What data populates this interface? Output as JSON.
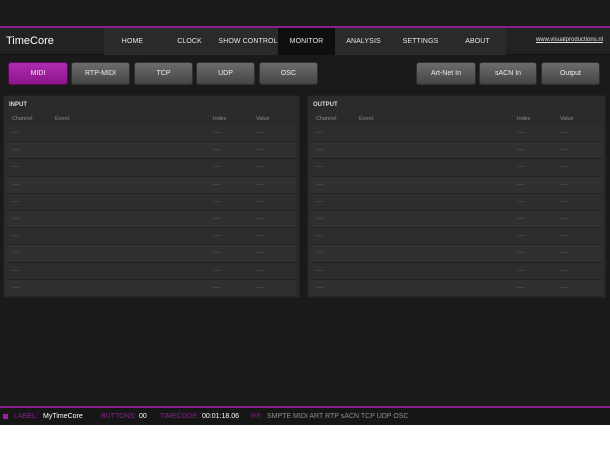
{
  "app": {
    "title": "TimeCore"
  },
  "nav": [
    {
      "label": "HOME"
    },
    {
      "label": "CLOCK"
    },
    {
      "label": "SHOW CONTROL"
    },
    {
      "label": "MONITOR"
    },
    {
      "label": "ANALYSIS"
    },
    {
      "label": "SETTINGS"
    },
    {
      "label": "ABOUT"
    }
  ],
  "site_link": "www.visualproductions.nl",
  "source_buttons": {
    "midi": "MIDI",
    "rtp_midi": "RTP-MIDI",
    "tcp": "TCP",
    "udp": "UDP",
    "osc": "OSC",
    "artnet_in": "Art-Net In",
    "sacn_in": "sACN In",
    "output": "Output"
  },
  "input": {
    "title": "INPUT",
    "columns": {
      "channel": "Channel",
      "event": "Event",
      "index": "Index",
      "value": "Value"
    },
    "rows": [
      {
        "channel": "----",
        "event": "-",
        "index": "----",
        "value": "----"
      },
      {
        "channel": "----",
        "event": "-",
        "index": "----",
        "value": "----"
      },
      {
        "channel": "----",
        "event": "-",
        "index": "----",
        "value": "----"
      },
      {
        "channel": "----",
        "event": "-",
        "index": "----",
        "value": "----"
      },
      {
        "channel": "----",
        "event": "-",
        "index": "----",
        "value": "----"
      },
      {
        "channel": "----",
        "event": "-",
        "index": "----",
        "value": "----"
      },
      {
        "channel": "----",
        "event": "-",
        "index": "----",
        "value": "----"
      },
      {
        "channel": "----",
        "event": "-",
        "index": "----",
        "value": "----"
      },
      {
        "channel": "----",
        "event": "-",
        "index": "----",
        "value": "----"
      },
      {
        "channel": "----",
        "event": "-",
        "index": "----",
        "value": "----"
      }
    ]
  },
  "output": {
    "title": "OUTPUT",
    "columns": {
      "channel": "Channel",
      "event": "Event",
      "index": "Index",
      "value": "Value"
    },
    "rows": [
      {
        "channel": "----",
        "event": "-",
        "index": "----",
        "value": "----"
      },
      {
        "channel": "----",
        "event": "-",
        "index": "----",
        "value": "----"
      },
      {
        "channel": "----",
        "event": "-",
        "index": "----",
        "value": "----"
      },
      {
        "channel": "----",
        "event": "-",
        "index": "----",
        "value": "----"
      },
      {
        "channel": "----",
        "event": "-",
        "index": "----",
        "value": "----"
      },
      {
        "channel": "----",
        "event": "-",
        "index": "----",
        "value": "----"
      },
      {
        "channel": "----",
        "event": "-",
        "index": "----",
        "value": "----"
      },
      {
        "channel": "----",
        "event": "-",
        "index": "----",
        "value": "----"
      },
      {
        "channel": "----",
        "event": "-",
        "index": "----",
        "value": "----"
      },
      {
        "channel": "----",
        "event": "-",
        "index": "----",
        "value": "----"
      }
    ]
  },
  "status": {
    "label_key": "LABEL:",
    "label_value": "MyTimeCore",
    "buttons_key": "BUTTONS:",
    "buttons_value": "00",
    "timecode_key": "TIMECODE:",
    "timecode_value": "00:01:18.06",
    "rx_key": "RX:",
    "rx_items": "SMPTE MIDI ART RTP sACN TCP UDP OSC"
  },
  "colors": {
    "accent": "#8a1f8a",
    "background": "#1a1a1a",
    "panel": "#2b2b2b"
  }
}
